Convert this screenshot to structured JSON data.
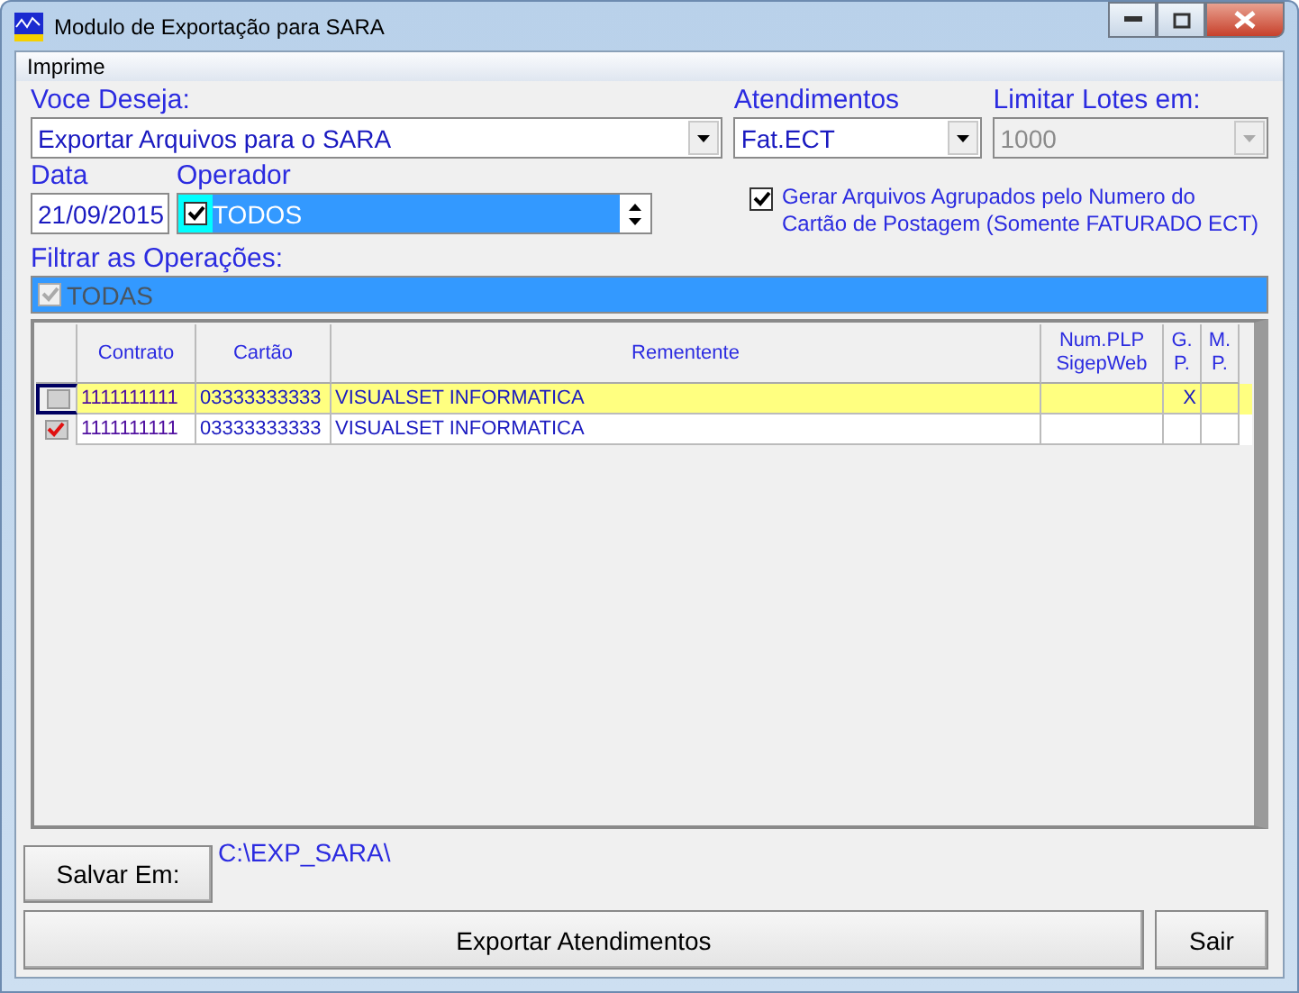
{
  "window": {
    "title": "Modulo de Exportação para SARA"
  },
  "menu": [
    "Imprime"
  ],
  "voce_deseja": {
    "label": "Voce Deseja:",
    "value": "Exportar Arquivos para o SARA"
  },
  "atendimentos": {
    "label": "Atendimentos",
    "value": "Fat.ECT"
  },
  "limitar_lotes": {
    "label": "Limitar Lotes em:",
    "value": "1000",
    "disabled": true
  },
  "data": {
    "label": "Data",
    "value": "21/09/2015"
  },
  "operador": {
    "label": "Operador",
    "value": "TODOS",
    "checked": true
  },
  "agrupar": {
    "label": "Gerar Arquivos Agrupados pelo Numero do Cartão de Postagem (Somente FATURADO ECT)",
    "checked": true
  },
  "filtrar": {
    "label": "Filtrar as Operações:",
    "value": "TODAS",
    "checked": true,
    "disabled": true
  },
  "table": {
    "columns": [
      "Contrato",
      "Cartão",
      "Rementente",
      "Num.PLP SigepWeb",
      "G. P.",
      "M. P."
    ],
    "rows": [
      {
        "contrato": "1111111111",
        "cartao": "03333333333",
        "remetente": "VISUALSET INFORMATICA",
        "gp": "X",
        "checked": false,
        "selected": true
      },
      {
        "contrato": "1111111111",
        "cartao": "03333333333",
        "remetente": "VISUALSET INFORMATICA",
        "gp": "",
        "checked": true,
        "selected": false
      }
    ]
  },
  "salvar": {
    "button": "Salvar Em:",
    "path": "C:\\EXP_SARA\\"
  },
  "buttons": {
    "export": "Exportar Atendimentos",
    "exit": "Sair"
  }
}
